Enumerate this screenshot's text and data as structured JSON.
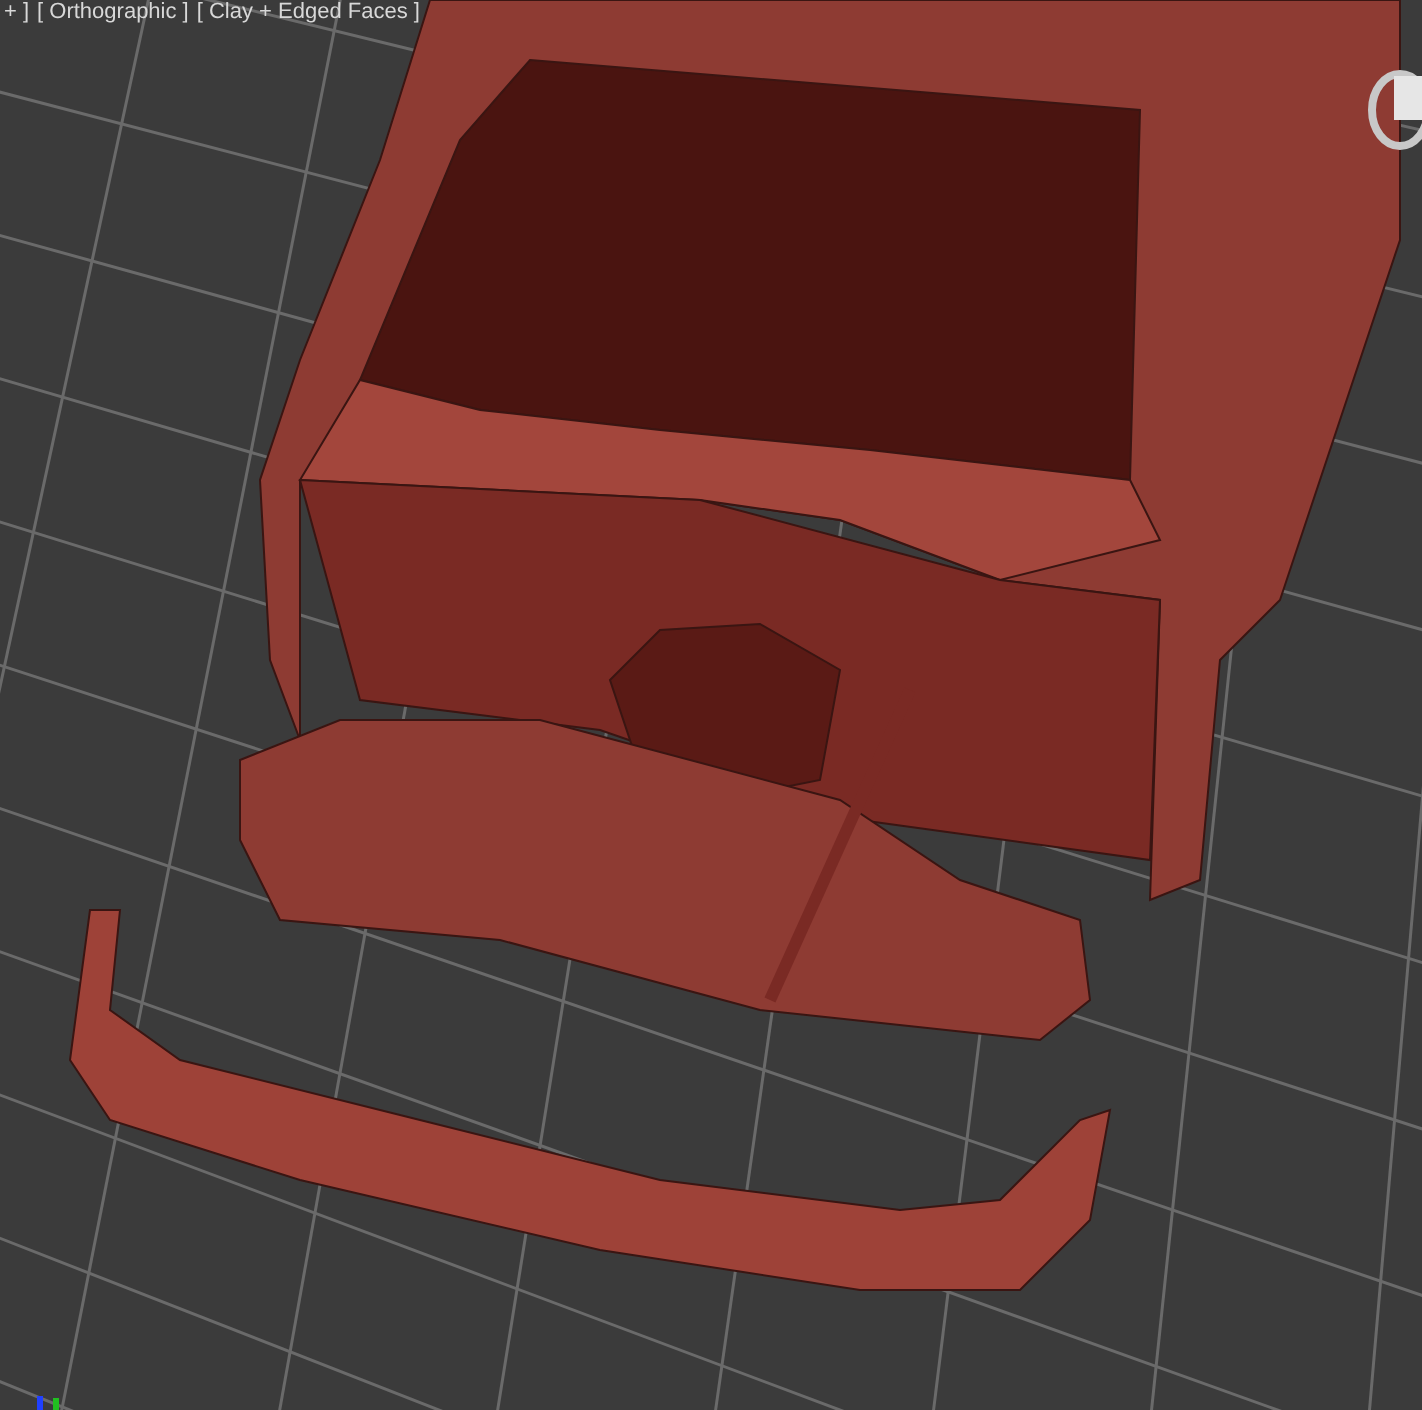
{
  "viewport": {
    "labels": [
      "+ ]",
      "[ Orthographic ]",
      "[ Clay + Edged Faces ]"
    ]
  }
}
